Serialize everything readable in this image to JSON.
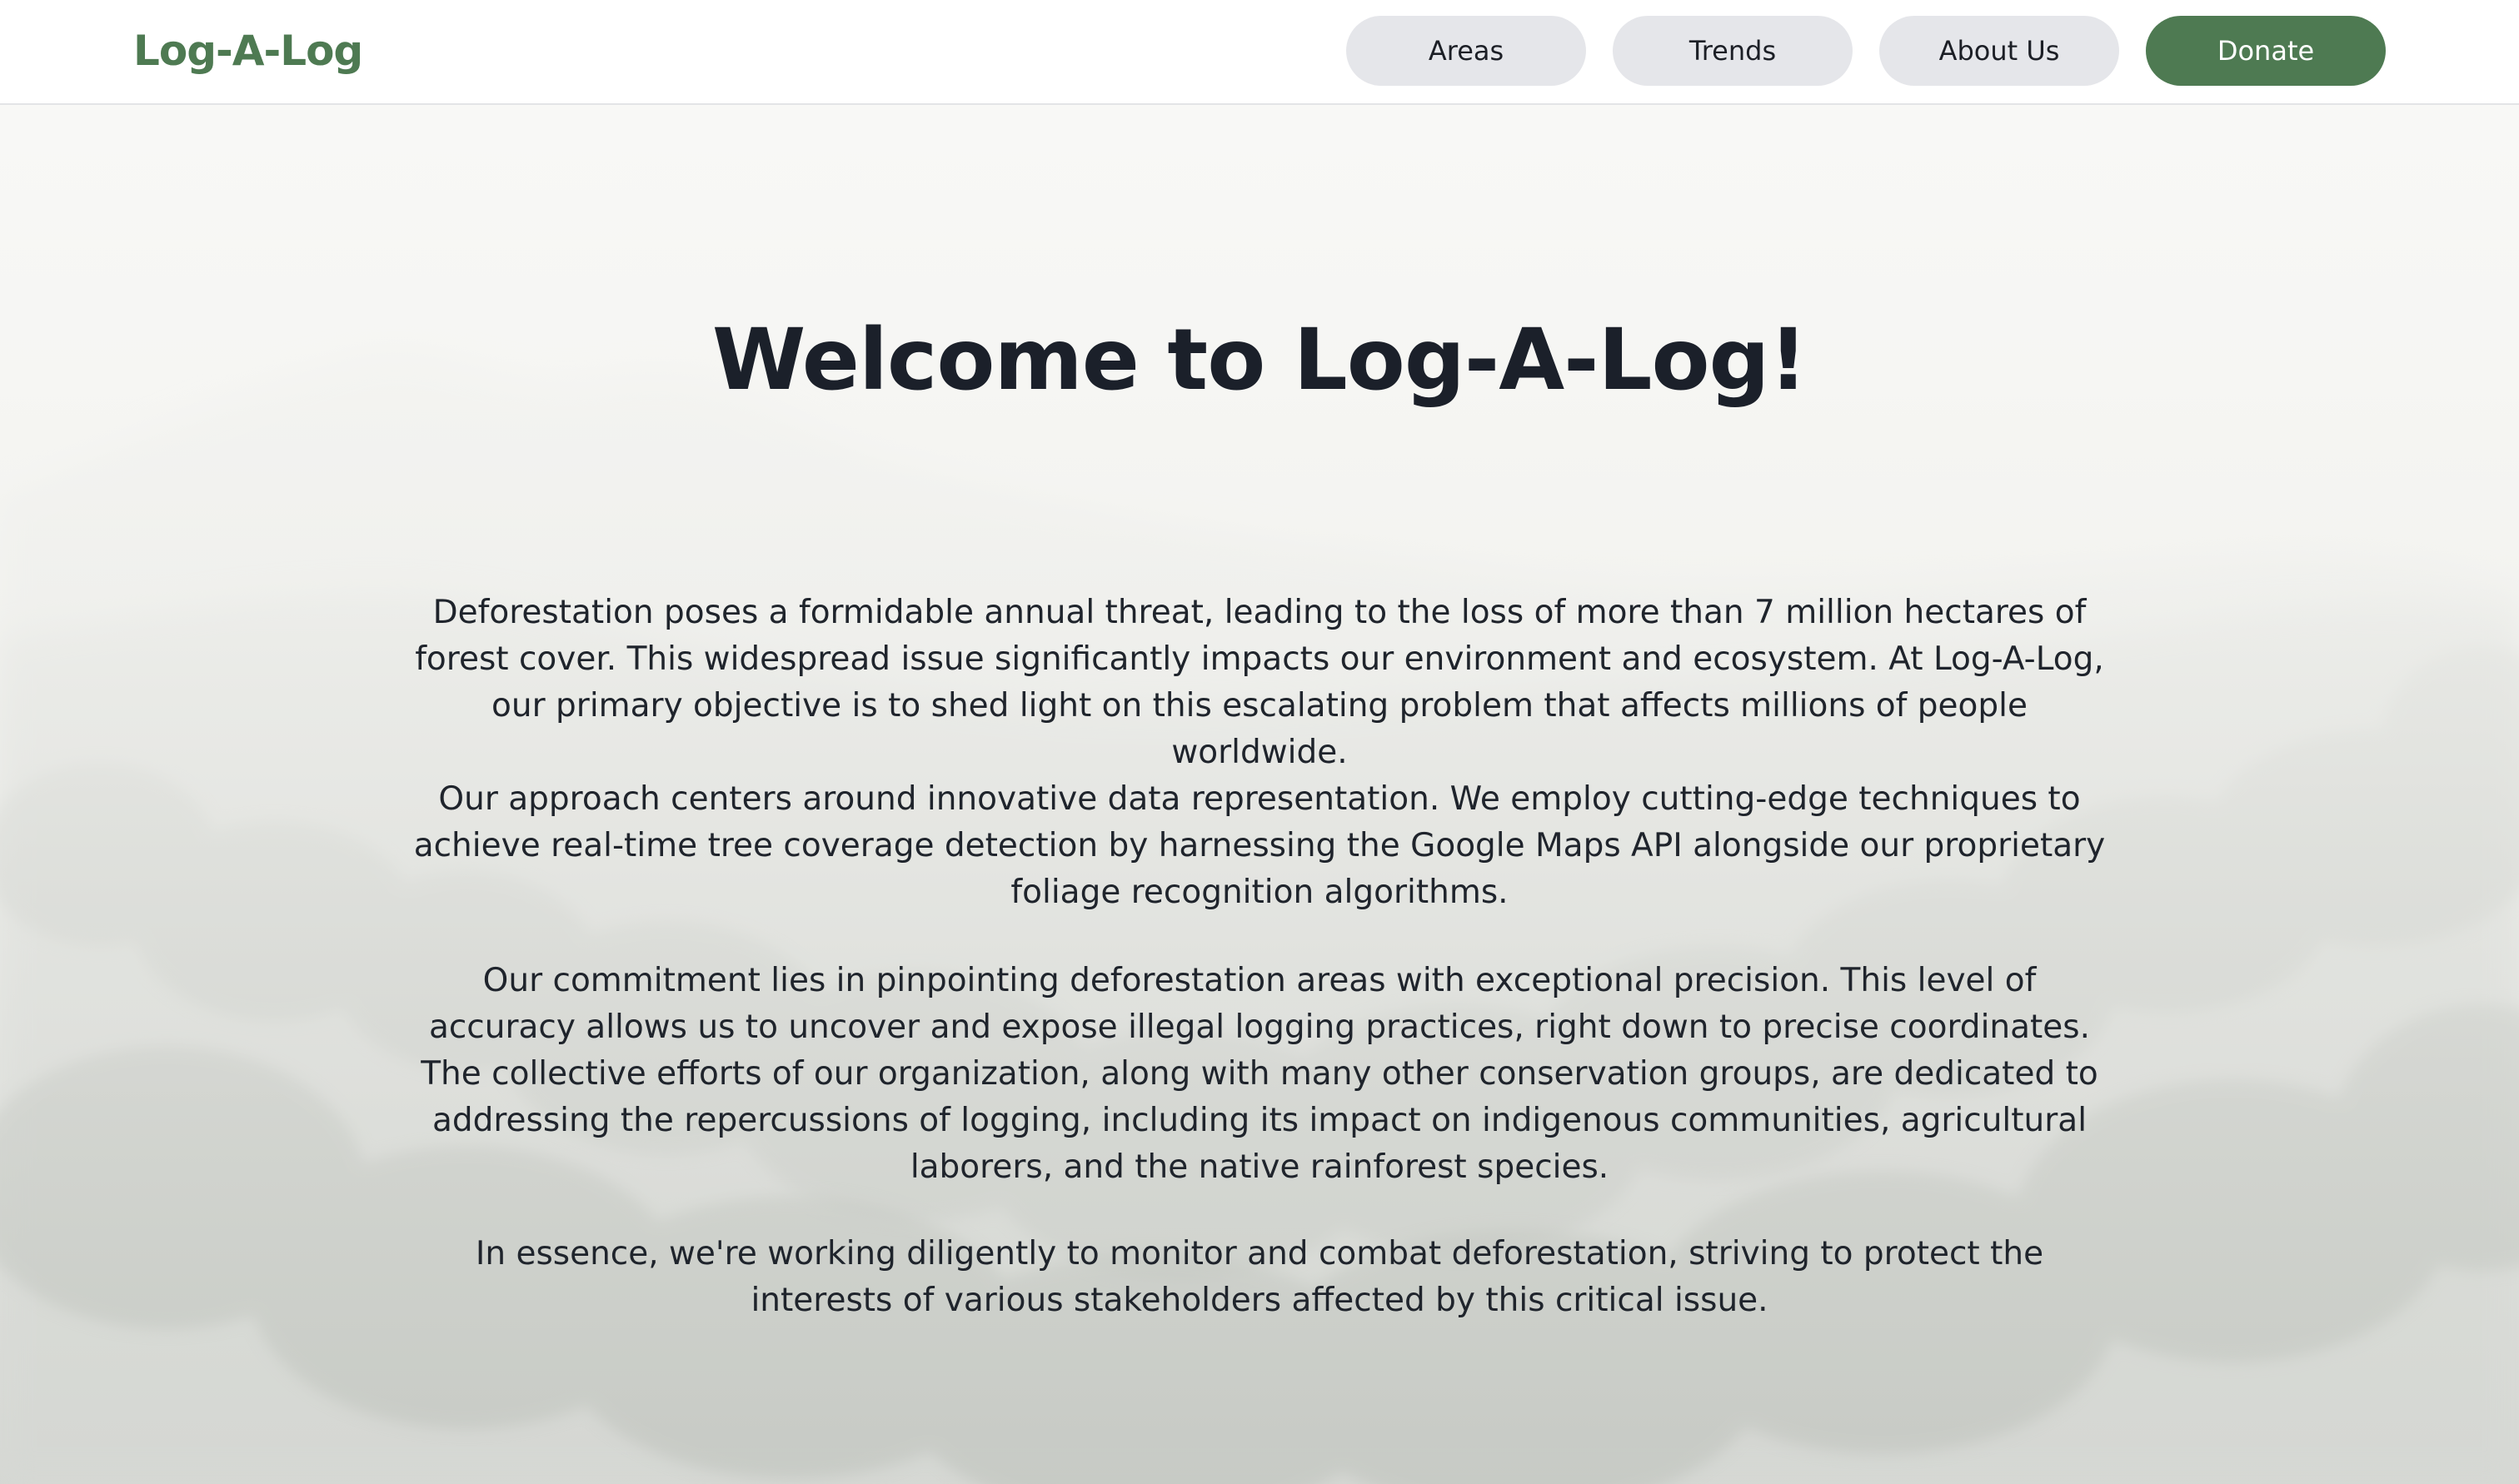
{
  "header": {
    "logo": "Log-A-Log",
    "nav": [
      {
        "label": "Areas"
      },
      {
        "label": "Trends"
      },
      {
        "label": "About Us"
      },
      {
        "label": "Donate"
      }
    ]
  },
  "hero": {
    "title": "Welcome to Log-A-Log!",
    "paragraphs": [
      "Deforestation poses a formidable annual threat, leading to the loss of more than 7 million hectares of forest cover. This widespread issue significantly impacts our environment and ecosystem. At Log-A-Log, our primary objective is to shed light on this escalating problem that affects millions of people worldwide.",
      "Our approach centers around innovative data representation. We employ cutting-edge techniques to achieve real-time tree coverage detection by harnessing the Google Maps API alongside our proprietary foliage recognition algorithms.",
      "Our commitment lies in pinpointing deforestation areas with exceptional precision. This level of accuracy allows us to uncover and expose illegal logging practices, right down to precise coordinates. The collective efforts of our organization, along with many other conservation groups, are dedicated to addressing the repercussions of logging, including its impact on indigenous communities, agricultural laborers, and the native rainforest species.",
      "In essence, we're working diligently to monitor and combat deforestation, striving to protect the interests of various stakeholders affected by this critical issue."
    ]
  },
  "colors": {
    "brand": "#4e7a52",
    "nav_button_bg": "#e5e6ea",
    "text": "#1f242c"
  }
}
